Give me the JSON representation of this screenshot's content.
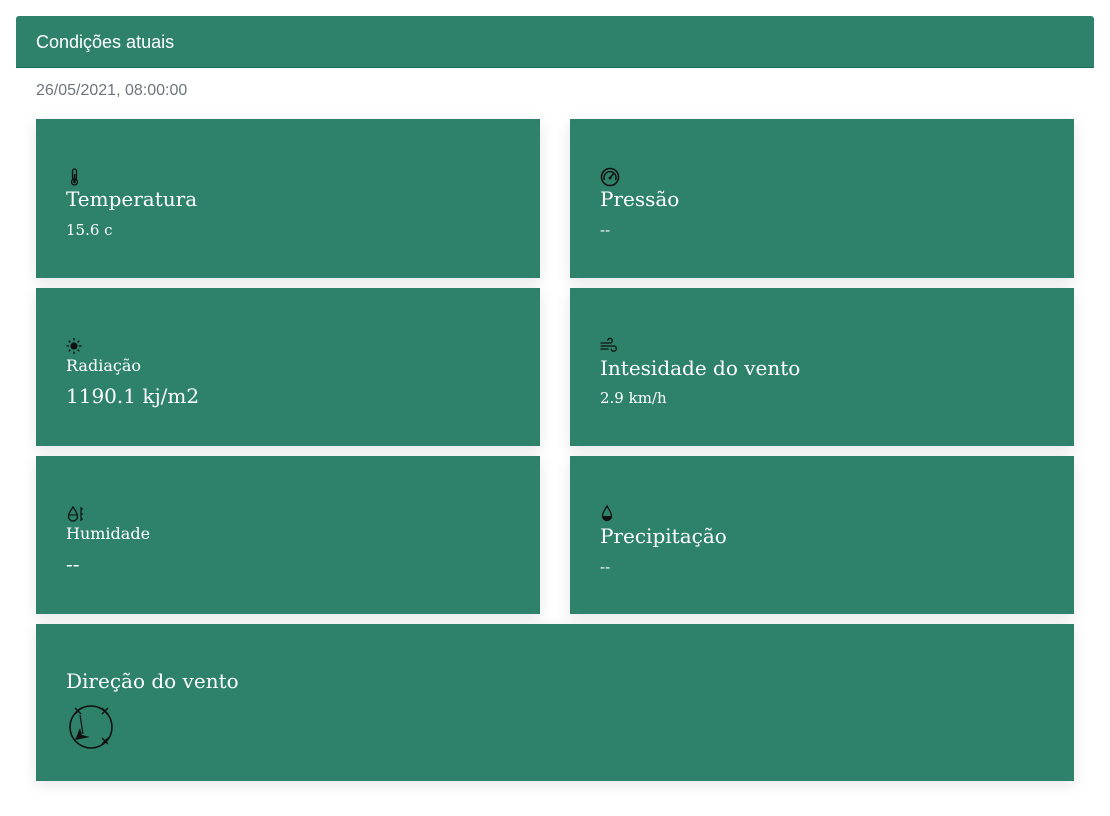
{
  "header": {
    "title": "Condições atuais"
  },
  "timestamp": "26/05/2021, 08:00:00",
  "cards": {
    "temperatura": {
      "icon": "thermometer-icon",
      "label": "Temperatura",
      "value": "15.6 c"
    },
    "pressao": {
      "icon": "gauge-icon",
      "label": "Pressão",
      "value": "--"
    },
    "radiacao": {
      "icon": "sun-icon",
      "label": "Radiação",
      "value": "1190.1 kj/m2"
    },
    "vento": {
      "icon": "wind-icon",
      "label": "Intesidade do vento",
      "value": "2.9 km/h"
    },
    "humidade": {
      "icon": "humidity-icon",
      "label": "Humidade",
      "value": "--"
    },
    "precipitacao": {
      "icon": "droplet-icon",
      "label": "Precipitação",
      "value": "--"
    },
    "direcao": {
      "icon": "compass-icon",
      "label": "Direção do vento"
    }
  },
  "colors": {
    "card_bg": "#2e826c",
    "header_bg": "#2e826c",
    "text": "#ffffff",
    "icon": "#111111"
  }
}
